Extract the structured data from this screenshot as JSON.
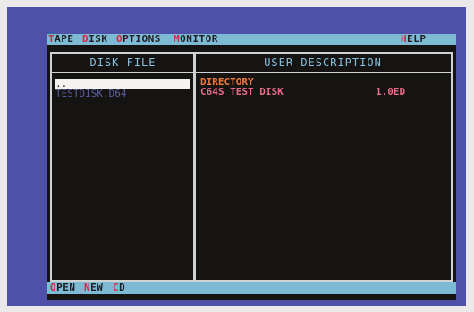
{
  "menu": {
    "tape": {
      "hotkey": "T",
      "rest": "APE"
    },
    "disk": {
      "hotkey": "D",
      "rest": "ISK"
    },
    "options": {
      "hotkey": "O",
      "rest": "PTIONS"
    },
    "monitor": {
      "hotkey": "M",
      "rest": "ONITOR"
    },
    "help": {
      "hotkey": "H",
      "rest": "ELP"
    }
  },
  "left_panel": {
    "header": "DISK FILE",
    "files": [
      "..",
      "TESTDISK.D64"
    ]
  },
  "right_panel": {
    "header": "USER DESCRIPTION",
    "title": "DIRECTORY",
    "entries": [
      {
        "name": "C64S TEST DISK",
        "version": "1.0ED"
      }
    ]
  },
  "statusbar": {
    "open": {
      "hotkey": "O",
      "rest": "PEN"
    },
    "new": {
      "hotkey": "N",
      "rest": "EW"
    },
    "cd": {
      "hotkey": "C",
      "rest": "D"
    }
  },
  "colors": {
    "border": "#4f50a7",
    "screen": "#161313",
    "bar": "#7dbad4",
    "hotkey": "#d32a44",
    "header_text": "#86c0dd",
    "directory_title": "#ec7a3c",
    "entry_text": "#e56d86"
  }
}
